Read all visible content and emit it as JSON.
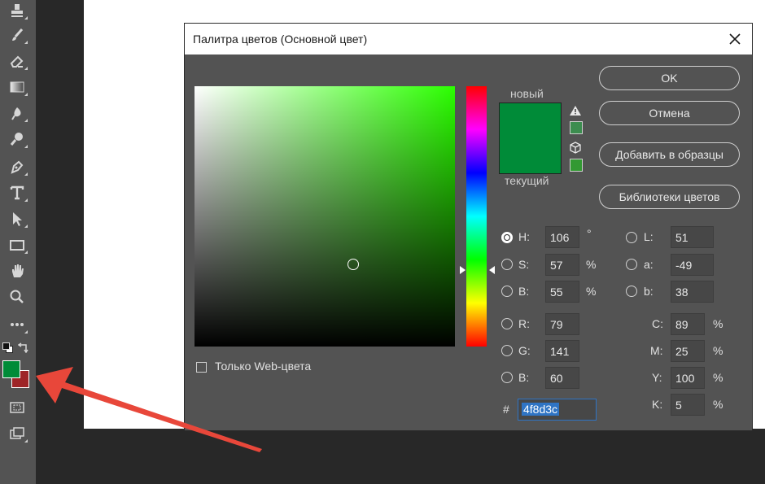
{
  "dialog": {
    "title": "Палитра цветов (Основной цвет)",
    "new_label": "новый",
    "current_label": "текущий",
    "new_color": "#008b38",
    "web_only_label": "Только Web-цвета",
    "buttons": {
      "ok": "OK",
      "cancel": "Отмена",
      "add_swatch": "Добавить в образцы",
      "libraries": "Библиотеки цветов"
    },
    "hsb": {
      "h_label": "H:",
      "h_value": "106",
      "h_unit": "°",
      "s_label": "S:",
      "s_value": "57",
      "s_unit": "%",
      "b_label": "B:",
      "b_value": "55",
      "b_unit": "%"
    },
    "rgb": {
      "r_label": "R:",
      "r_value": "79",
      "g_label": "G:",
      "g_value": "141",
      "b_label": "B:",
      "b_value": "60"
    },
    "lab": {
      "l_label": "L:",
      "l_value": "51",
      "a_label": "a:",
      "a_value": "-49",
      "b_label": "b:",
      "b_value": "38"
    },
    "cmyk": {
      "c_label": "C:",
      "c_value": "89",
      "m_label": "M:",
      "m_value": "25",
      "y_label": "Y:",
      "y_value": "100",
      "k_label": "K:",
      "k_value": "5",
      "unit": "%"
    },
    "hex_label": "#",
    "hex_value": "4f8d3c"
  },
  "toolbar": {
    "foreground_color": "#008b38",
    "background_color": "#9e2427"
  },
  "annotation": {
    "arrow_color": "#e8473a"
  }
}
